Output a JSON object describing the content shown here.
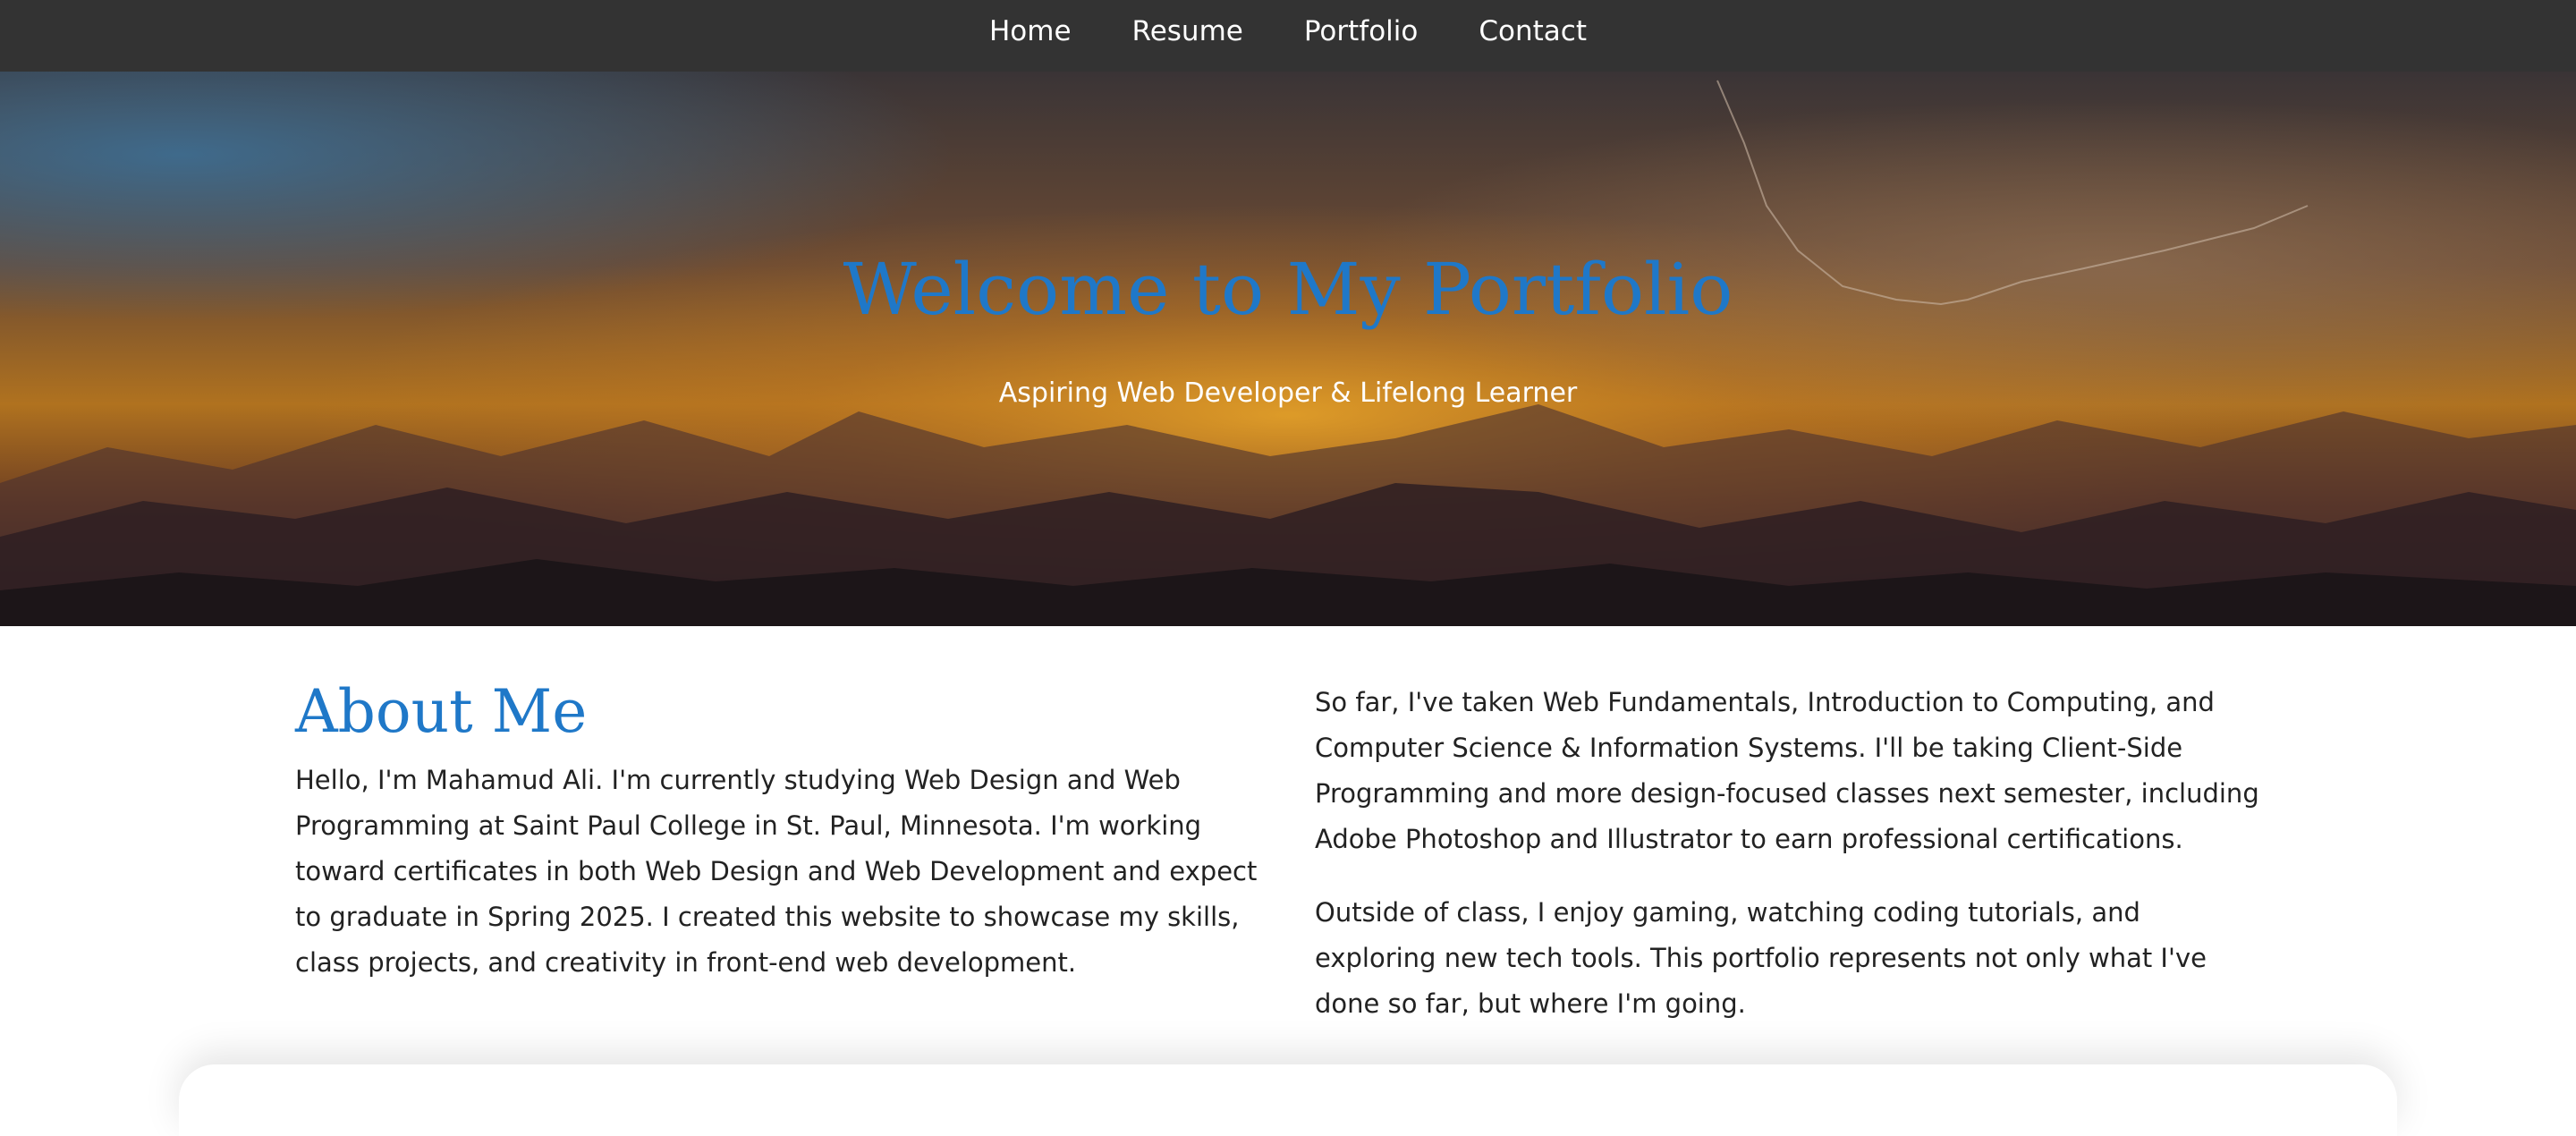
{
  "nav": {
    "items": [
      {
        "label": "Home"
      },
      {
        "label": "Resume"
      },
      {
        "label": "Portfolio"
      },
      {
        "label": "Contact"
      }
    ]
  },
  "hero": {
    "title": "Welcome to My Portfolio",
    "subtitle": "Aspiring Web Developer & Lifelong Learner"
  },
  "about": {
    "title": "About Me",
    "left_paragraph": "Hello, I'm Mahamud Ali. I'm currently studying Web Design and Web Programming at Saint Paul College in St. Paul, Minnesota. I'm working toward certificates in both Web Design and Web Development and expect to graduate in Spring 2025. I created this website to showcase my skills, class projects, and creativity in front-end web development.",
    "right_paragraphs": [
      "So far, I've taken Web Fundamentals, Introduction to Computing, and Computer Science & Information Systems. I'll be taking Client-Side Programming and more design-focused classes next semester, including Adobe Photoshop and Illustrator to earn professional certifications.",
      "Outside of class, I enjoy gaming, watching coding tutorials, and exploring new tech tools. This portfolio represents not only what I've done so far, but where I'm going."
    ]
  },
  "colors": {
    "accent": "#1f78c8",
    "navbar": "#333333",
    "text": "#222222"
  }
}
